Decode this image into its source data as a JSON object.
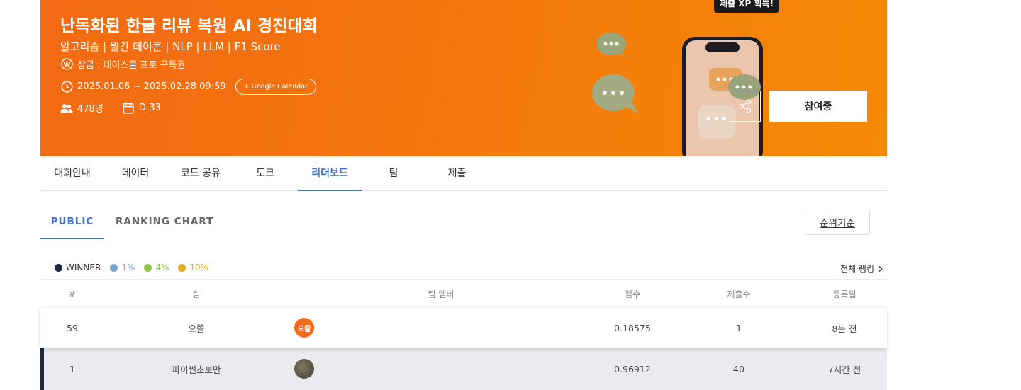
{
  "banner": {
    "title": "난독화된 한글 리뷰 복원 AI 경진대회",
    "tags": "알고리즘 | 월간 데이콘 | NLP | LLM | F1 Score",
    "prize": "상금 : 데이스쿨 프로 구독권",
    "period": "2025.01.06 ~ 2025.02.28 09:59",
    "gcal_label": "+ Google Calendar",
    "participants": "478명",
    "dday": "D-33",
    "xp_tooltip": "제출 XP 획득!",
    "join_label": "참여중",
    "colors": {
      "start": "#f26a13",
      "end": "#f58a06"
    }
  },
  "tabs": [
    {
      "label": "대회안내"
    },
    {
      "label": "데이터"
    },
    {
      "label": "코드 공유"
    },
    {
      "label": "토크"
    },
    {
      "label": "리더보드"
    },
    {
      "label": "팀"
    },
    {
      "label": "제출"
    }
  ],
  "subtabs": [
    {
      "label": "PUBLIC"
    },
    {
      "label": "RANKING CHART"
    }
  ],
  "criteria_label": "순위기준",
  "legend": [
    {
      "label": "WINNER",
      "color": "#1e2a44"
    },
    {
      "label": "1%",
      "color": "#7ba7cf"
    },
    {
      "label": "4%",
      "color": "#8cc43b"
    },
    {
      "label": "10%",
      "color": "#e9a91f"
    }
  ],
  "full_ranking_label": "전체 랭킹",
  "table": {
    "headers": {
      "rank": "#",
      "team": "팀",
      "members": "팀 멤버",
      "score": "점수",
      "submissions": "제출수",
      "registered": "등록일"
    },
    "rows": [
      {
        "rank": "59",
        "team": "으쫄",
        "avatar_text": "으쫄",
        "score": "0.18575",
        "submissions": "1",
        "registered": "8분 전"
      },
      {
        "rank": "1",
        "team": "파이썬초보만",
        "avatar_text": "",
        "score": "0.96912",
        "submissions": "40",
        "registered": "7시간 전"
      }
    ]
  },
  "accent_color": "#3d72c8"
}
